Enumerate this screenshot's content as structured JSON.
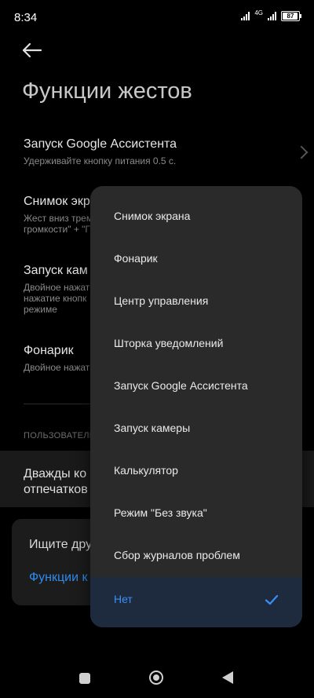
{
  "status_bar": {
    "time": "8:34",
    "network": "4G",
    "battery": "87"
  },
  "header": {
    "back_icon": "arrow-left-icon",
    "title": "Функции жестов"
  },
  "settings": {
    "items": [
      {
        "title": "Запуск Google Ассистента",
        "subtitle": "Удерживайте кнопку питания 0.5 с."
      },
      {
        "title": "Снимок экр",
        "subtitle_lines": [
          "Жест вниз трем",
          "громкости\" + \"Г"
        ]
      },
      {
        "title": "Запуск кам",
        "subtitle_lines": [
          "Двойное нажат",
          "нажатие кнопк",
          "режиме"
        ]
      },
      {
        "title": "Фонарик",
        "subtitle": "Двойное нажат"
      }
    ],
    "section_label": "ПОЛЬЗОВАТЕЛЬ",
    "highlight_row": {
      "line1": "Дважды ко",
      "line2": "отпечатков"
    }
  },
  "card": {
    "question": "Ищите дру",
    "link": "Функции к"
  },
  "menu": {
    "options": [
      {
        "label": "Снимок экрана",
        "selected": false
      },
      {
        "label": "Фонарик",
        "selected": false
      },
      {
        "label": "Центр управления",
        "selected": false
      },
      {
        "label": "Шторка уведомлений",
        "selected": false
      },
      {
        "label": "Запуск Google Ассистента",
        "selected": false
      },
      {
        "label": "Запуск камеры",
        "selected": false
      },
      {
        "label": "Калькулятор",
        "selected": false
      },
      {
        "label": "Режим \"Без звука\"",
        "selected": false
      },
      {
        "label": "Сбор журналов проблем",
        "selected": false
      },
      {
        "label": "Нет",
        "selected": true
      }
    ],
    "accent": "#3b8ef3",
    "selected_bg": "#1e2b3f"
  },
  "navbar": {
    "icons": [
      "recents-square-icon",
      "home-circle-icon",
      "back-triangle-icon"
    ]
  }
}
